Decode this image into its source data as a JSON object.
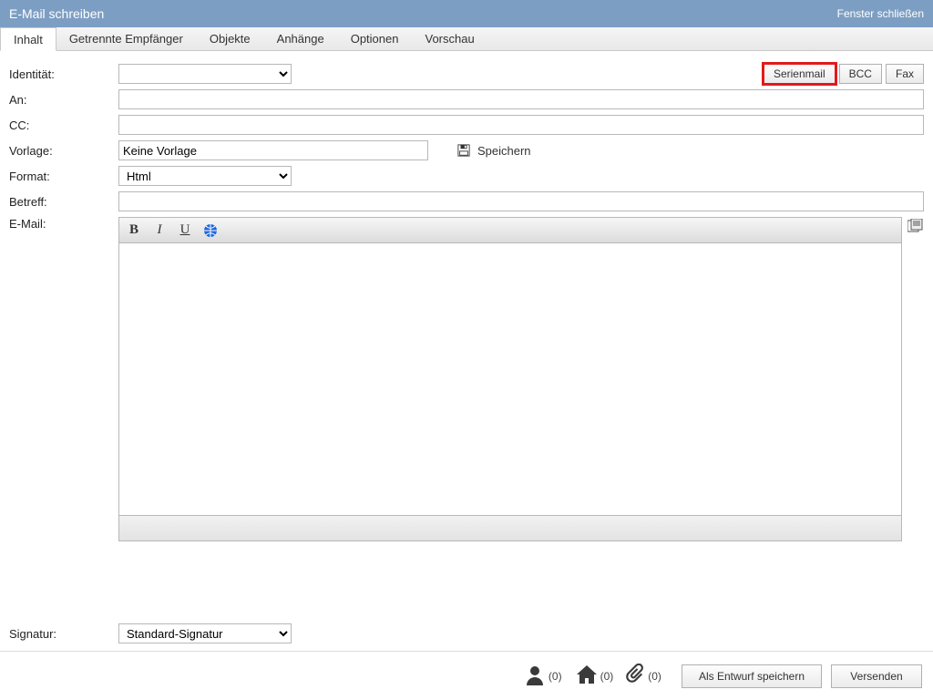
{
  "window": {
    "title": "E-Mail schreiben",
    "close": "Fenster schließen"
  },
  "tabs": {
    "items": [
      {
        "label": "Inhalt",
        "active": true
      },
      {
        "label": "Getrennte Empfänger"
      },
      {
        "label": "Objekte"
      },
      {
        "label": "Anhänge"
      },
      {
        "label": "Optionen"
      },
      {
        "label": "Vorschau"
      }
    ]
  },
  "top_buttons": {
    "serienmail": "Serienmail",
    "bcc": "BCC",
    "fax": "Fax"
  },
  "labels": {
    "identity": "Identität:",
    "to": "An:",
    "cc": "CC:",
    "template": "Vorlage:",
    "format": "Format:",
    "subject": "Betreff:",
    "email": "E-Mail:",
    "signature": "Signatur:",
    "save": "Speichern"
  },
  "fields": {
    "identity_value": "",
    "to_value": "",
    "cc_value": "",
    "template_value": "Keine Vorlage",
    "format_value": "Html",
    "subject_value": "",
    "signature_value": "Standard-Signatur"
  },
  "footer": {
    "contacts_count": "(0)",
    "houses_count": "(0)",
    "attach_count": "(0)",
    "draft": "Als Entwurf speichern",
    "send": "Versenden"
  }
}
